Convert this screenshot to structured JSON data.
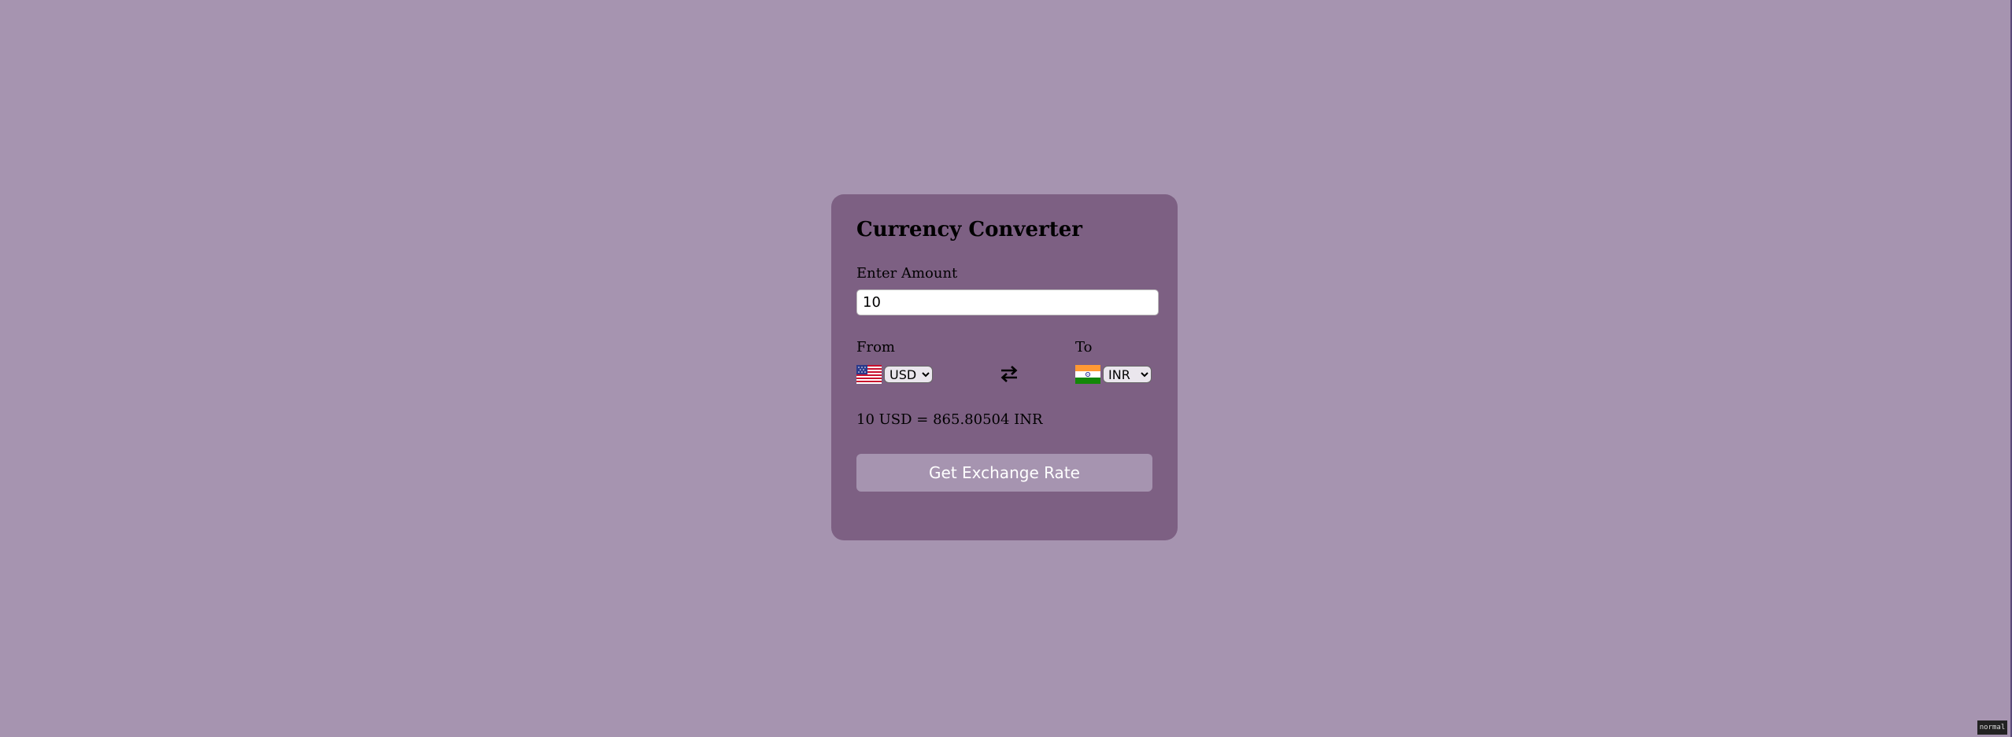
{
  "converter": {
    "title": "Currency Converter",
    "amount_label": "Enter Amount",
    "amount_value": "10",
    "from_label": "From",
    "to_label": "To",
    "from_currency": "USD",
    "to_currency": "INR",
    "from_flag": "us-flag-icon",
    "to_flag": "india-flag-icon",
    "swap_icon": "swap-arrows-icon",
    "result_text": "10 USD = 865.80504 INR",
    "button_label": "Get Exchange Rate"
  },
  "status": {
    "mode": "normal"
  },
  "colors": {
    "page_background": "#a694b0",
    "card_background": "#7d6083",
    "button_background": "#a694b0",
    "button_text": "#ffffff"
  }
}
